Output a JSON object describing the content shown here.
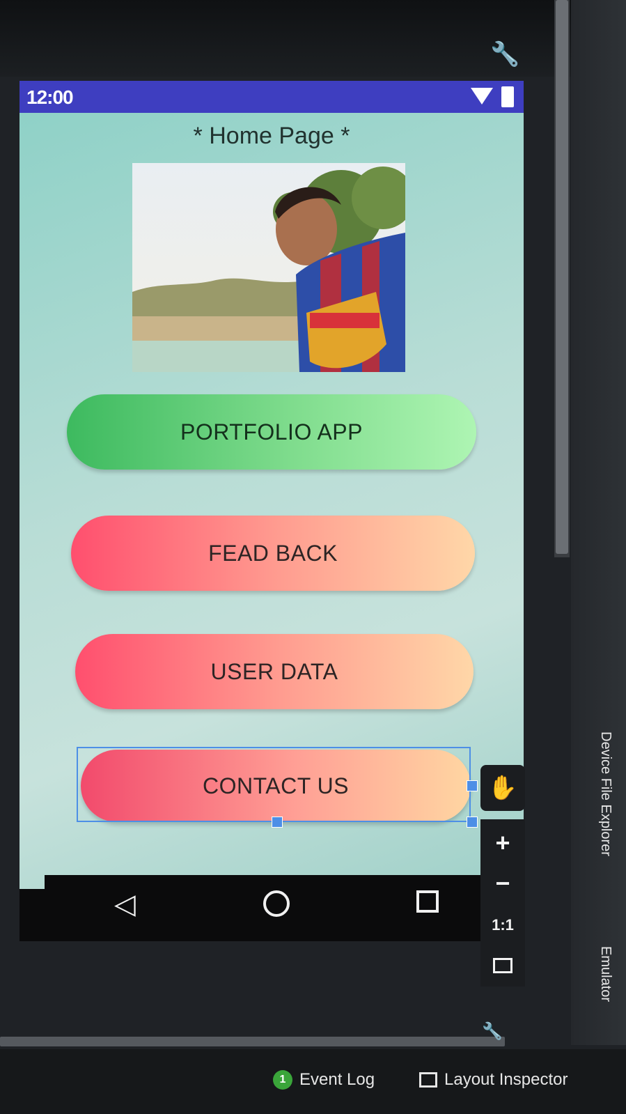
{
  "status_bar": {
    "time": "12:00"
  },
  "screen": {
    "title": "* Home Page *",
    "buttons": {
      "portfolio": "PORTFOLIO APP",
      "feedback": "FEAD BACK",
      "user_data": "USER DATA",
      "contact": "CONTACT US"
    }
  },
  "emulator_toolbar": {
    "zoom_actual": "1:1"
  },
  "side_panel": {
    "device_file_explorer": "Device File Explorer",
    "emulator": "Emulator"
  },
  "bottom_bar": {
    "event_log_count": "1",
    "event_log": "Event Log",
    "layout_inspector": "Layout Inspector"
  },
  "icons": {
    "wrench": "wrench-icon",
    "wifi": "wifi-icon",
    "battery": "battery-icon",
    "back": "back-icon",
    "home": "home-icon",
    "recent": "recent-apps-icon",
    "hand": "hand-icon",
    "zoom_in": "zoom-in-icon",
    "zoom_out": "zoom-out-icon",
    "fit": "fit-screen-icon"
  },
  "colors": {
    "status_bar": "#3e3ec0",
    "portfolio_button": "#3dba5f",
    "pink_button": "#ff4f6e",
    "peach": "#ffd7a8",
    "selection": "#4d8fe6"
  }
}
